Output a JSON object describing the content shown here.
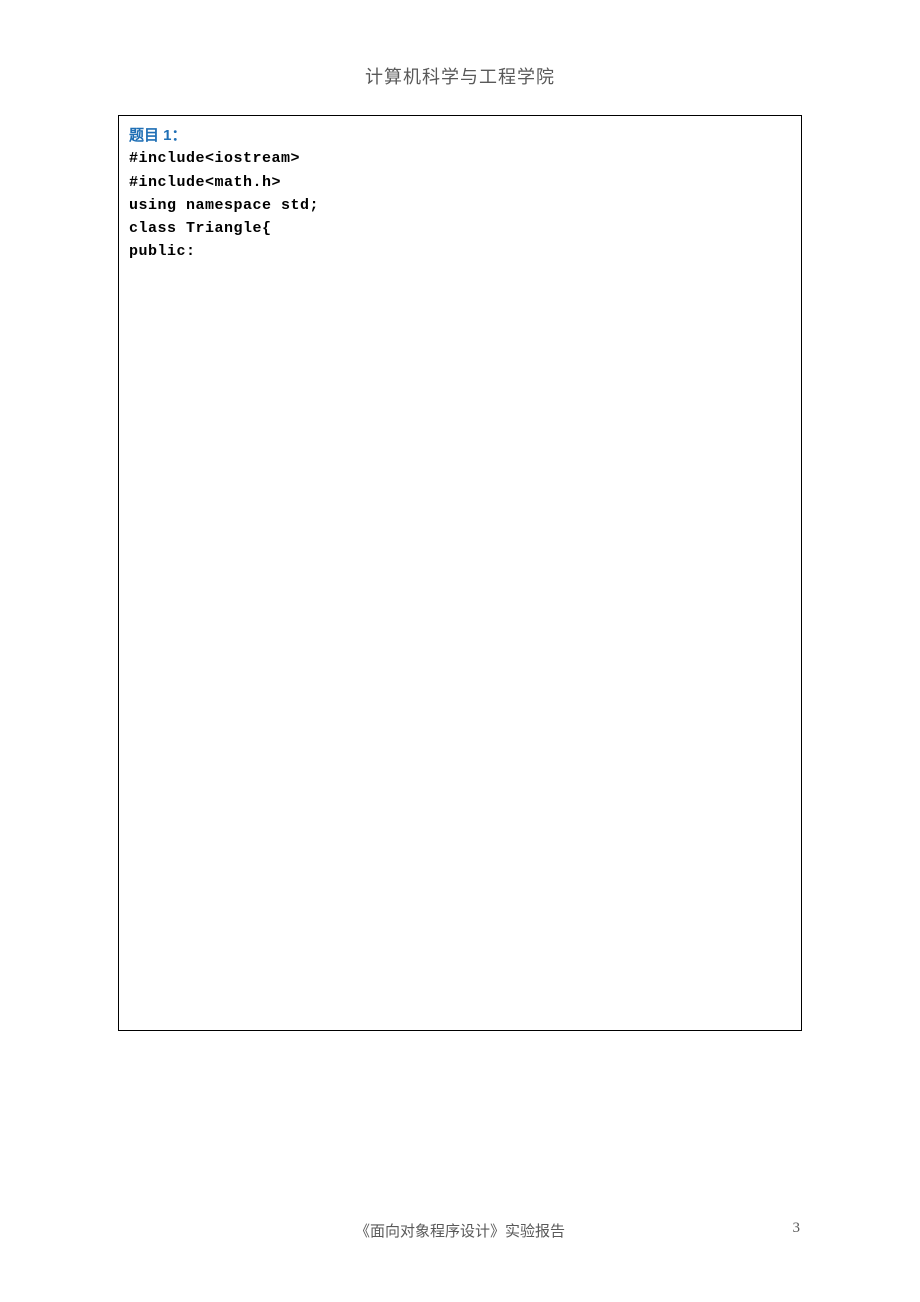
{
  "header": {
    "title": "计算机科学与工程学院"
  },
  "content": {
    "heading": "题目 1：",
    "code_lines": [
      "#include<iostream>",
      "#include<math.h>",
      "using namespace std;",
      "class Triangle{",
      "public:"
    ]
  },
  "footer": {
    "center": "《面向对象程序设计》实验报告",
    "page_number": "3"
  }
}
